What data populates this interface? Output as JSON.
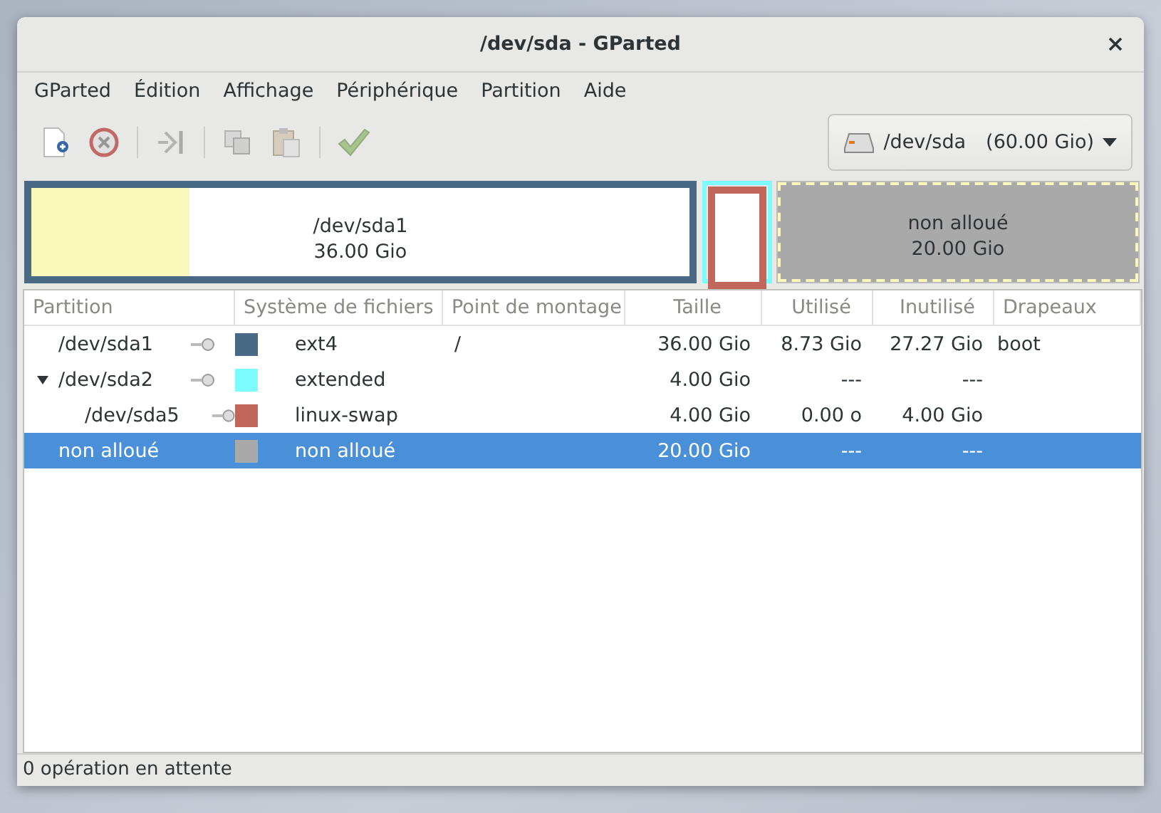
{
  "window": {
    "title": "/dev/sda - GParted"
  },
  "menu": [
    "GParted",
    "Édition",
    "Affichage",
    "Périphérique",
    "Partition",
    "Aide"
  ],
  "toolbar": [
    {
      "kind": "new",
      "disabled": false
    },
    {
      "kind": "delete",
      "disabled": true
    },
    {
      "kind": "sep"
    },
    {
      "kind": "resize",
      "disabled": true
    },
    {
      "kind": "sep"
    },
    {
      "kind": "copy",
      "disabled": true
    },
    {
      "kind": "paste",
      "disabled": true
    },
    {
      "kind": "sep"
    },
    {
      "kind": "apply",
      "disabled": true
    }
  ],
  "device": {
    "label": "/dev/sda",
    "size": "(60.00 Gio)"
  },
  "disk_map": [
    {
      "kind": "primary",
      "name": "/dev/sda1",
      "size": "36.00 Gio",
      "color": "#4a6984",
      "level": 0.24
    },
    {
      "kind": "extended",
      "color": "#7dfcfe",
      "children": [
        {
          "kind": "primary",
          "color": "#c1665a"
        }
      ]
    },
    {
      "kind": "unallocated",
      "name": "non alloué",
      "size": "20.00 Gio",
      "color": "#a9a9a9"
    }
  ],
  "table": {
    "columns": [
      "Partition",
      "Système de fichiers",
      "Point de montage",
      "Taille",
      "Utilisé",
      "Inutilisé",
      "Drapeaux"
    ],
    "rows": [
      {
        "partition": "/dev/sda1",
        "locked": true,
        "color": "#4a6984",
        "fs": "ext4",
        "mount": "/",
        "size": "36.00 Gio",
        "used": "8.73 Gio",
        "unused": "27.27 Gio",
        "flags": "boot",
        "selected": false
      },
      {
        "partition": "/dev/sda2",
        "locked": true,
        "color": "#7dfcfe",
        "fs": "extended",
        "size": "4.00 Gio",
        "used": "---",
        "unused": "---",
        "selected": false,
        "expanded": true,
        "children": [
          {
            "partition": "/dev/sda5",
            "locked": true,
            "color": "#c1665a",
            "fs": "linux-swap",
            "size": "4.00 Gio",
            "used": "0.00 o",
            "unused": "4.00 Gio",
            "selected": false
          }
        ]
      },
      {
        "partition": "non alloué",
        "locked": false,
        "color": "#a9a9a9",
        "fs": "non alloué",
        "size": "20.00 Gio",
        "used": "---",
        "unused": "---",
        "selected": true
      }
    ]
  },
  "status_bar": "0 opération en attente"
}
